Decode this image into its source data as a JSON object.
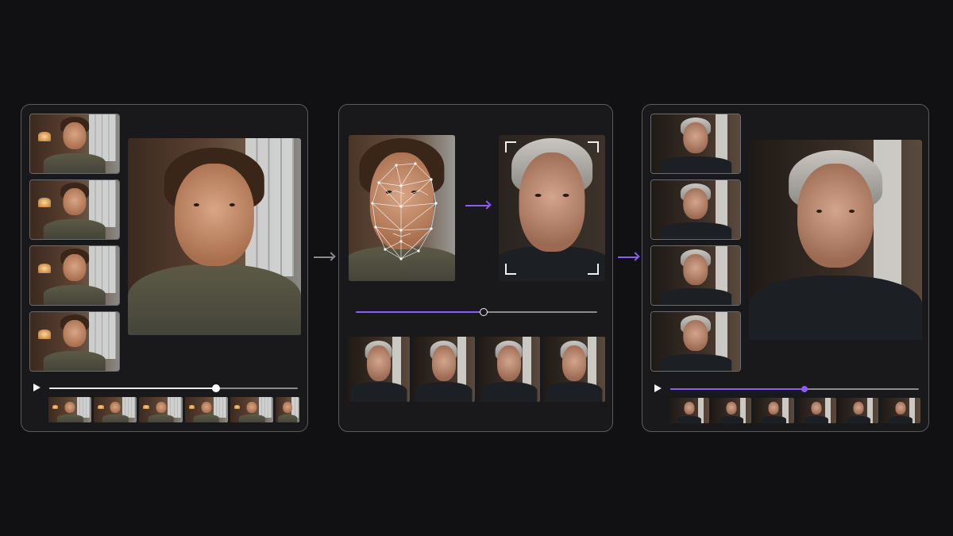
{
  "colors": {
    "background": "#111114",
    "panel_border": "#5a5a60",
    "accent": "#8b5cf6",
    "source_progress": "#e8e8e8",
    "arrow_gray": "#8a8a90"
  },
  "source_panel": {
    "thumbnails": [
      "frame-1",
      "frame-2",
      "frame-3",
      "frame-4"
    ],
    "progress": 0.67,
    "filmstrip_frames": 6
  },
  "swap_panel": {
    "source_face_icon": "face-mesh-icon",
    "target_face_icon": "face-target-frame-icon",
    "blend": 0.53,
    "filmstrip_frames": 4
  },
  "result_panel": {
    "thumbnails": [
      "frame-1",
      "frame-2",
      "frame-3",
      "frame-4"
    ],
    "progress": 0.54,
    "filmstrip_frames": 6
  }
}
